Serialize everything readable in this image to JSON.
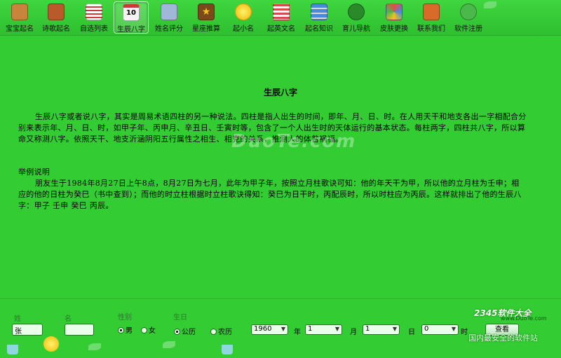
{
  "toolbar": {
    "items": [
      {
        "label": "宝宝起名",
        "icon": "baby-book-icon",
        "color": "#c8843a"
      },
      {
        "label": "诗歌起名",
        "icon": "poetry-book-icon",
        "color": "#b85a2a"
      },
      {
        "label": "自选列表",
        "icon": "list-icon",
        "color": "#d23a3a"
      },
      {
        "label": "生辰八字",
        "icon": "calendar-icon",
        "color": "#f4f4f4",
        "badge": "10"
      },
      {
        "label": "姓名评分",
        "icon": "score-chart-icon",
        "color": "#9fb8d8"
      },
      {
        "label": "星座推算",
        "icon": "star-icon",
        "color": "#7a4a1a"
      },
      {
        "label": "起小名",
        "icon": "sun-flower-icon",
        "color": "#f7c21a"
      },
      {
        "label": "起英文名",
        "icon": "us-flag-icon",
        "color": "#d84a4a"
      },
      {
        "label": "起名知识",
        "icon": "books-icon",
        "color": "#4a8ad8"
      },
      {
        "label": "育儿导航",
        "icon": "footprint-icon",
        "color": "#2a8a2a"
      },
      {
        "label": "皮肤更换",
        "icon": "palette-icon",
        "color": "#e8e8e8"
      },
      {
        "label": "联系我们",
        "icon": "house-icon",
        "color": "#d86a2a"
      },
      {
        "label": "软件注册",
        "icon": "users-icon",
        "color": "#4ab84a"
      }
    ]
  },
  "content": {
    "title": "生辰八字",
    "paragraph1": "生辰八字或者说八字，其实是周易术语四柱的另一种说法。四柱是指人出生的时间，即年、月、日、时。在人用天干和地支各出一字相配合分别来表示年、月、日、时，如甲子年、丙申月、辛丑日、壬寅时等，包含了一个人出生时的天体运行的基本状态。每柱两字，四柱共八字，所以算命又称测八字。依照天干、地支沂涵阴阳五行属性之相生、相克的关系，推测人的体咎祸福。",
    "example_heading": "举例说明",
    "paragraph2": "朋友生于1984年8月27日上午8点，8月27日为七月，此年为甲子年，按照立月柱歌诀可知：他的年天干为甲，所以他的立月柱为壬申；相应的他的日柱为癸巳（书中查到）；而他的时立柱根据时立柱歌诀得知：癸巳为日干时，丙配辰时，所以时柱应为丙辰。这样就排出了他的生辰八字：甲子 壬申 癸巳 丙辰。",
    "watermark": "DuoTe.com"
  },
  "form": {
    "surname_label": "姓",
    "surname_value": "张",
    "name_label": "名",
    "name_value": "",
    "gender_label": "性别",
    "gender_male": "男",
    "gender_female": "女",
    "birthday_label": "生日",
    "calendar_solar": "公历",
    "calendar_lunar": "农历",
    "year_value": "1960",
    "year_unit": "年",
    "month_value": "1",
    "month_unit": "月",
    "day_value": "1",
    "day_unit": "日",
    "hour_value": "0",
    "hour_unit": "时",
    "view_button": "查看"
  },
  "branding": {
    "logo": "2345软件大全",
    "site": "www.DuoTe.com",
    "tagline": "国内最安全的软件站"
  }
}
